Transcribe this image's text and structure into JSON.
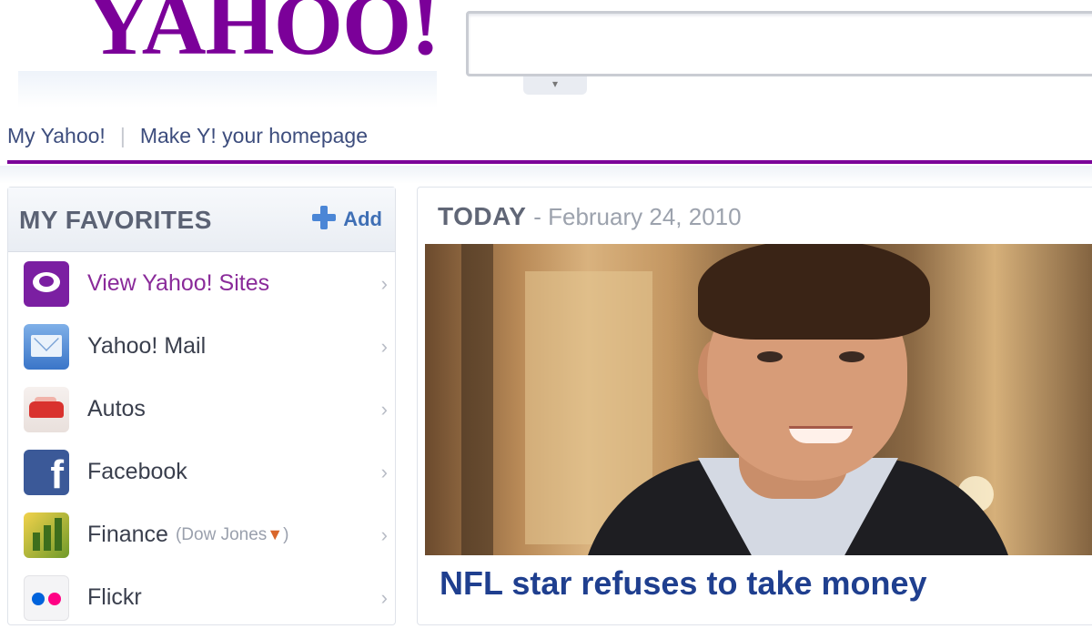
{
  "header": {
    "logo_text": "YAHOO!",
    "brand_color": "#7b0099",
    "search_placeholder": "",
    "links": [
      "My Yahoo!",
      "Make Y! your homepage"
    ]
  },
  "sidebar": {
    "title": "MY FAVORITES",
    "add_label": "Add",
    "items": [
      {
        "label": "View Yahoo! Sites",
        "icon": "yahoo-sites-icon"
      },
      {
        "label": "Yahoo! Mail",
        "icon": "mail-icon"
      },
      {
        "label": "Autos",
        "icon": "car-icon"
      },
      {
        "label": "Facebook",
        "icon": "facebook-icon"
      },
      {
        "label": "Finance",
        "sub": "(Dow Jones",
        "sub_close": ")",
        "icon": "finance-icon"
      },
      {
        "label": "Flickr",
        "icon": "flickr-icon"
      }
    ]
  },
  "main": {
    "today_label": "TODAY",
    "date_text": "- February 24, 2010",
    "headline": "NFL star refuses to take money"
  }
}
